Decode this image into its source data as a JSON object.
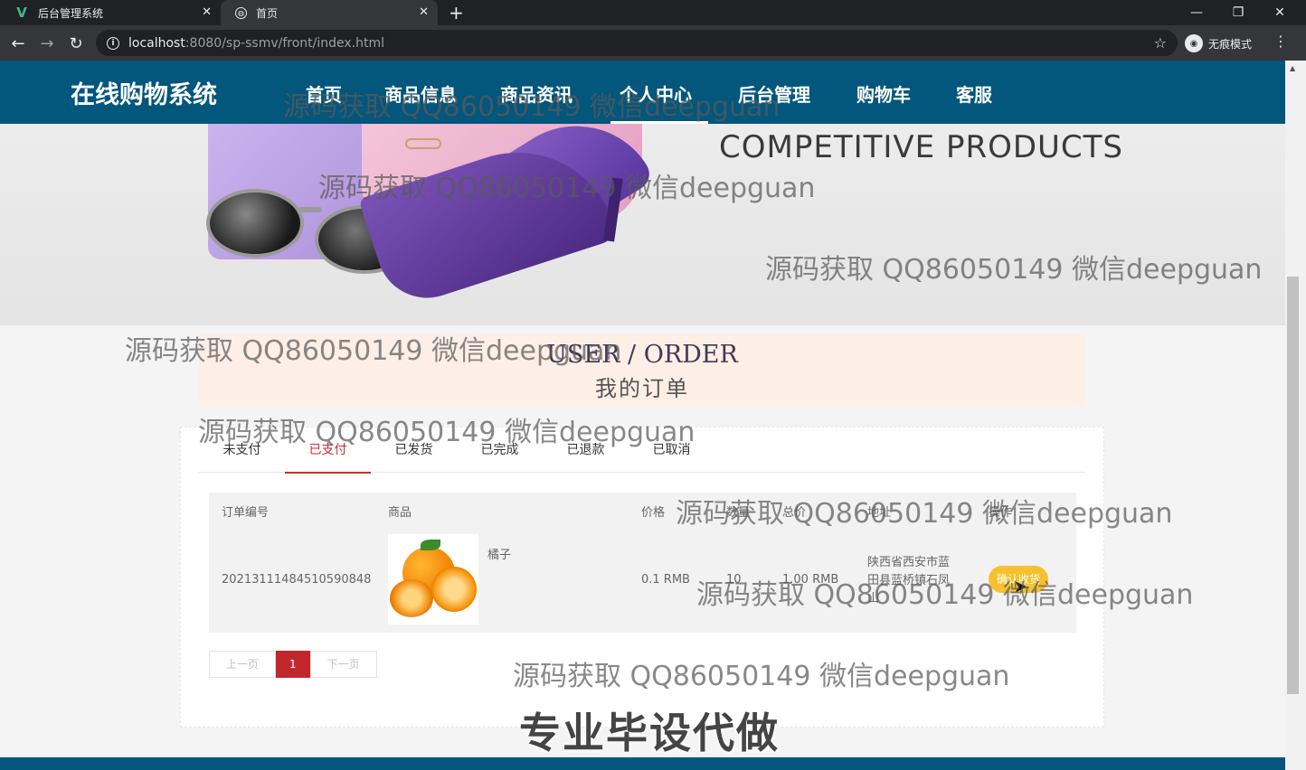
{
  "browser": {
    "tabs": [
      {
        "title": "后台管理系统",
        "icon": "vue-logo-icon"
      },
      {
        "title": "首页",
        "icon": "globe-icon",
        "active": true
      }
    ],
    "url_host": "localhost",
    "url_rest": ":8080/sp-ssmv/front/index.html",
    "incognito_label": "无痕模式"
  },
  "site": {
    "title": "在线购物系统",
    "nav": [
      "首页",
      "商品信息",
      "商品资讯",
      "个人中心",
      "后台管理",
      "购物车",
      "客服"
    ],
    "active_nav": "个人中心"
  },
  "banner": {
    "text": "COMPETITIVE PRODUCTS",
    "slide_count": 5,
    "active_slide": 1
  },
  "order_section": {
    "title_en": "USER / ORDER",
    "title_cn": "我的订单",
    "tabs": [
      "未支付",
      "已支付",
      "已发货",
      "已完成",
      "已退款",
      "已取消"
    ],
    "active_tab": "已支付",
    "columns": [
      "订单编号",
      "商品",
      "价格",
      "数量",
      "总价",
      "地址",
      "操作"
    ],
    "rows": [
      {
        "order_no": "20213111484510590848",
        "product_name": "橘子",
        "product_image": "orange-image",
        "price": "0.1 RMB",
        "quantity": "10",
        "total": "1.00 RMB",
        "address_line1": "陕西省西安市蓝",
        "address_line2": "田县蓝桥镇石凤",
        "address_line3": "山",
        "action": "确认收货"
      }
    ],
    "pagination": {
      "prev": "上一页",
      "current": "1",
      "next": "下一页"
    }
  },
  "watermarks": {
    "repeat": "源码获取 QQ86050149 微信deepguan",
    "footer": "专业毕设代做"
  }
}
